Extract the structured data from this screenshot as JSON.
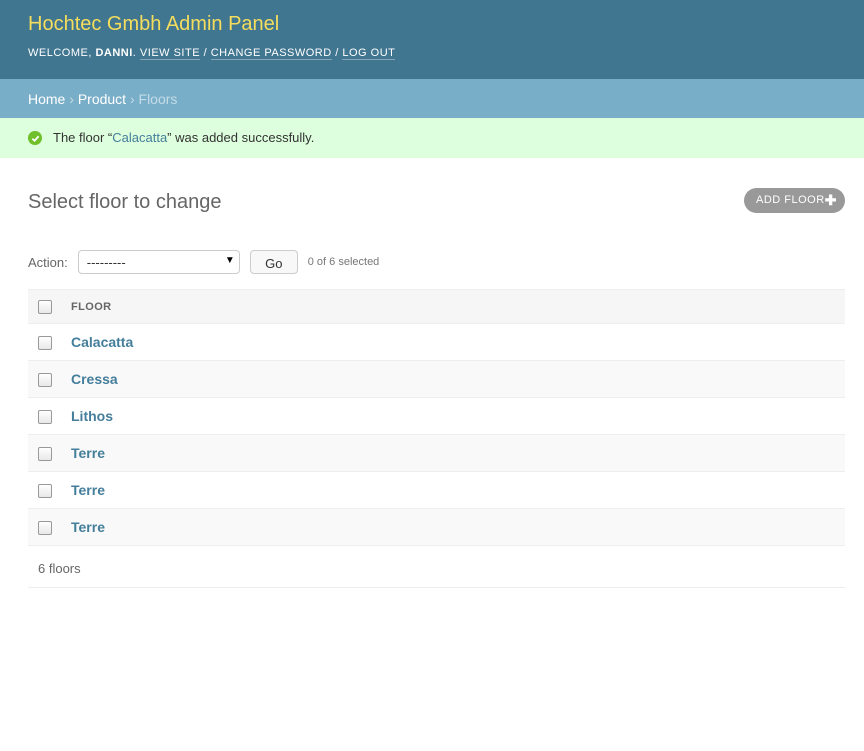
{
  "header": {
    "branding": "Hochtec Gmbh Admin Panel",
    "welcome": "Welcome, ",
    "username": "Danni",
    "view_site": "View site",
    "change_password": "Change password",
    "log_out": "Log out"
  },
  "breadcrumbs": {
    "home": "Home",
    "app": "Product",
    "current": "Floors"
  },
  "message": {
    "prefix": "The floor “",
    "link": "Calacatta",
    "suffix": "” was added successfully.",
    "color": "#70bf2b"
  },
  "content": {
    "title": "Select floor to change",
    "add_button": "Add floor"
  },
  "actions": {
    "label": "Action:",
    "selected": "---------",
    "go": "Go",
    "counter": "0 of 6 selected"
  },
  "table": {
    "column_header": "Floor",
    "rows": [
      "Calacatta",
      "Cressa",
      "Lithos",
      "Terre",
      "Terre",
      "Terre"
    ]
  },
  "paginator": "6 floors",
  "colors": {
    "header_bg": "#417690",
    "branding": "#f5dd5d",
    "breadcrumb_bg": "#79aec8",
    "success_bg": "#ddffdd",
    "link": "#447e9b"
  }
}
